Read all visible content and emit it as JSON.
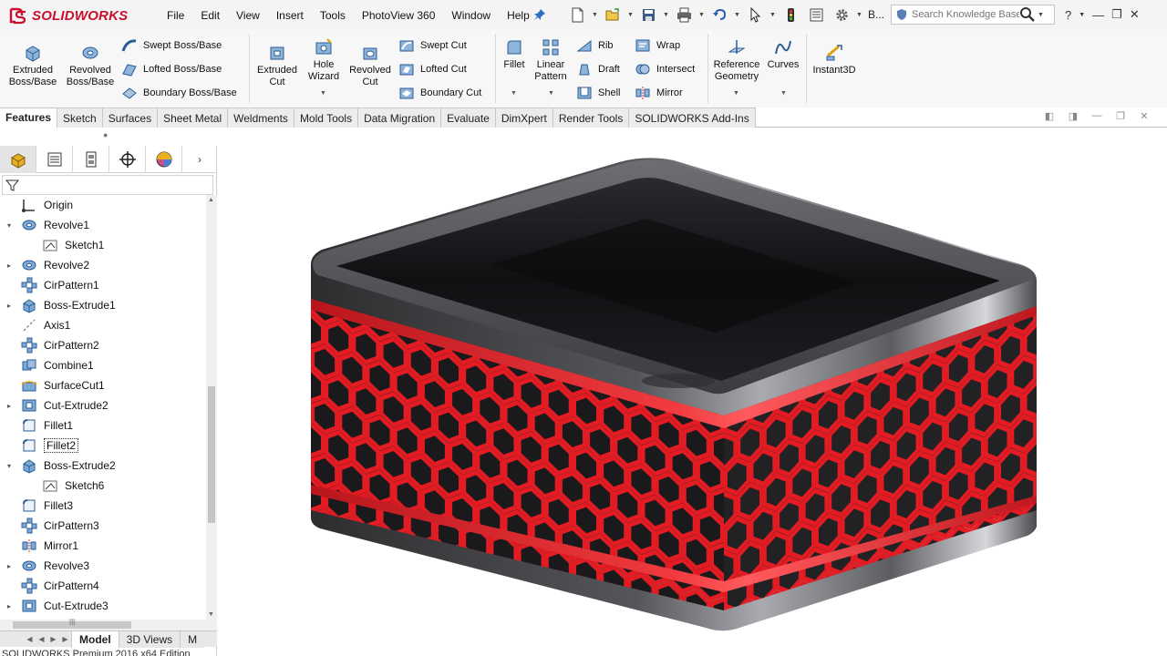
{
  "app": {
    "brand": "SOLIDWORKS",
    "status_text": "SOLIDWORKS Premium 2016 x64 Edition"
  },
  "menu": [
    "File",
    "Edit",
    "View",
    "Insert",
    "Tools",
    "PhotoView 360",
    "Window",
    "Help"
  ],
  "quick_access": {
    "truncated_label": "B..."
  },
  "search": {
    "placeholder": "Search Knowledge Base"
  },
  "ribbon": {
    "extruded_boss": "Extruded Boss/Base",
    "revolved_boss": "Revolved Boss/Base",
    "swept_boss": "Swept Boss/Base",
    "lofted_boss": "Lofted Boss/Base",
    "boundary_boss": "Boundary Boss/Base",
    "extruded_cut": "Extruded Cut",
    "hole_wizard": "Hole Wizard",
    "revolved_cut": "Revolved Cut",
    "swept_cut": "Swept Cut",
    "lofted_cut": "Lofted Cut",
    "boundary_cut": "Boundary Cut",
    "fillet": "Fillet",
    "linear_pattern": "Linear Pattern",
    "rib": "Rib",
    "draft": "Draft",
    "shell": "Shell",
    "wrap": "Wrap",
    "intersect": "Intersect",
    "mirror": "Mirror",
    "reference_geometry": "Reference Geometry",
    "curves": "Curves",
    "instant3d": "Instant3D"
  },
  "command_tabs": [
    "Features",
    "Sketch",
    "Surfaces",
    "Sheet Metal",
    "Weldments",
    "Mold Tools",
    "Data Migration",
    "Evaluate",
    "DimXpert",
    "Render Tools",
    "SOLIDWORKS Add-Ins"
  ],
  "active_command_tab": "Features",
  "tree": [
    {
      "label": "Origin",
      "icon": "origin-icon",
      "expander": "",
      "indent": 0
    },
    {
      "label": "Revolve1",
      "icon": "revolve-icon",
      "expander": "▾",
      "indent": 0
    },
    {
      "label": "Sketch1",
      "icon": "sketch-icon",
      "expander": "",
      "indent": 1
    },
    {
      "label": "Revolve2",
      "icon": "revolve-icon",
      "expander": "▸",
      "indent": 0
    },
    {
      "label": "CirPattern1",
      "icon": "circular-pattern-icon",
      "expander": "",
      "indent": 0
    },
    {
      "label": "Boss-Extrude1",
      "icon": "extrude-icon",
      "expander": "▸",
      "indent": 0
    },
    {
      "label": "Axis1",
      "icon": "axis-icon",
      "expander": "",
      "indent": 0
    },
    {
      "label": "CirPattern2",
      "icon": "circular-pattern-icon",
      "expander": "",
      "indent": 0
    },
    {
      "label": "Combine1",
      "icon": "combine-icon",
      "expander": "",
      "indent": 0
    },
    {
      "label": "SurfaceCut1",
      "icon": "surface-cut-icon",
      "expander": "",
      "indent": 0
    },
    {
      "label": "Cut-Extrude2",
      "icon": "cut-extrude-icon",
      "expander": "▸",
      "indent": 0
    },
    {
      "label": "Fillet1",
      "icon": "fillet-icon",
      "expander": "",
      "indent": 0
    },
    {
      "label": "Fillet2",
      "icon": "fillet-icon",
      "expander": "",
      "indent": 0,
      "selected": true
    },
    {
      "label": "Boss-Extrude2",
      "icon": "extrude-icon",
      "expander": "▾",
      "indent": 0
    },
    {
      "label": "Sketch6",
      "icon": "sketch-icon",
      "expander": "",
      "indent": 1
    },
    {
      "label": "Fillet3",
      "icon": "fillet-icon",
      "expander": "",
      "indent": 0
    },
    {
      "label": "CirPattern3",
      "icon": "circular-pattern-icon",
      "expander": "",
      "indent": 0
    },
    {
      "label": "Mirror1",
      "icon": "mirror-icon",
      "expander": "",
      "indent": 0
    },
    {
      "label": "Revolve3",
      "icon": "revolve-icon",
      "expander": "▸",
      "indent": 0
    },
    {
      "label": "CirPattern4",
      "icon": "circular-pattern-icon",
      "expander": "",
      "indent": 0
    },
    {
      "label": "Cut-Extrude3",
      "icon": "cut-extrude-icon",
      "expander": "▸",
      "indent": 0
    }
  ],
  "bottom_tabs": [
    "Model",
    "3D Views",
    "M"
  ],
  "active_bottom_tab": "Model",
  "colors": {
    "accent_red": "#e31b23",
    "metal_dark": "#3a3a3c",
    "brand_red": "#c8102e"
  }
}
